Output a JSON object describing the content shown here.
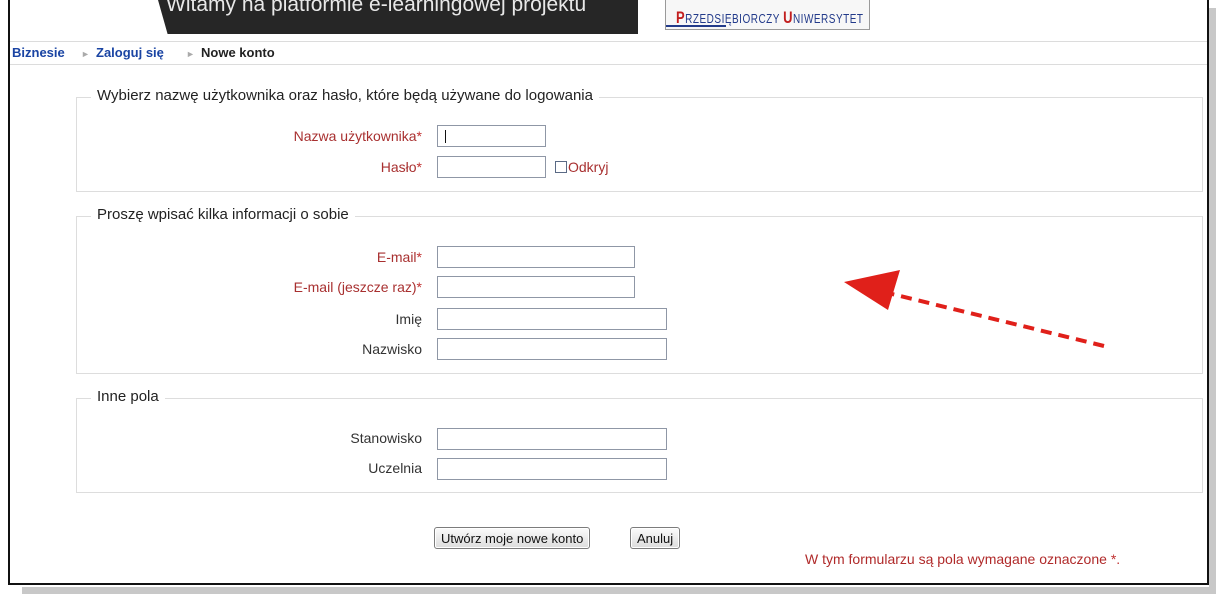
{
  "header": {
    "banner_text": "Witamy na platformie e-learningowej projektu",
    "logo_text_1_cap": "P",
    "logo_text_1": "RZEDSIĘBIORCZY ",
    "logo_text_2_cap": "U",
    "logo_text_2": "NIWERSYTET"
  },
  "breadcrumb": {
    "home": "Biznesie",
    "login": "Zaloguj się",
    "current": "Nowe konto",
    "separator": "►"
  },
  "section_login": {
    "legend": "Wybierz nazwę użytkownika oraz hasło, które będą używane do logowania",
    "username_label": "Nazwa użytkownika",
    "username_value": "",
    "password_label": "Hasło",
    "password_value": "",
    "reveal_label": "Odkryj",
    "required_mark": "*"
  },
  "section_info": {
    "legend": "Proszę wpisać kilka informacji o sobie",
    "email_label": "E-mail",
    "email_value": "",
    "email2_label": "E-mail (jeszcze raz)",
    "email2_value": "",
    "firstname_label": "Imię",
    "firstname_value": "",
    "lastname_label": "Nazwisko",
    "lastname_value": ""
  },
  "section_other": {
    "legend": "Inne pola",
    "position_label": "Stanowisko",
    "position_value": "",
    "university_label": "Uczelnia",
    "university_value": ""
  },
  "actions": {
    "submit_label": "Utwórz moje nowe konto",
    "cancel_label": "Anuluj"
  },
  "required_note": "W tym formularzu są pola wymagane oznaczone",
  "required_note_mark": "*.",
  "colors": {
    "required_label": "#a83030",
    "link": "#1a44a3",
    "arrow": "#e0201a"
  }
}
